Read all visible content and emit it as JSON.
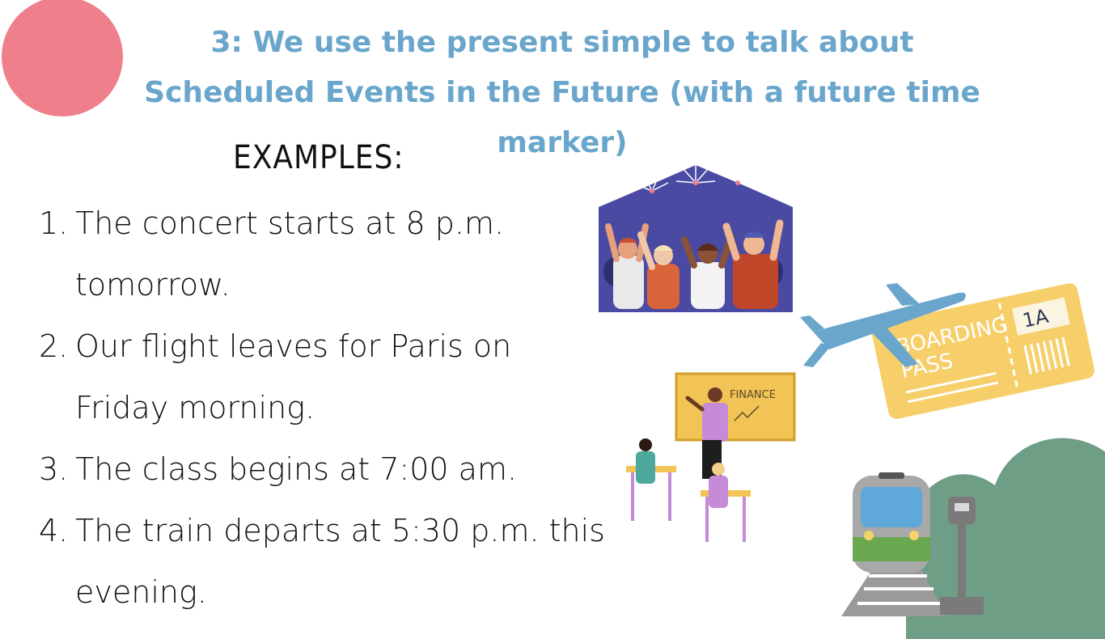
{
  "title_line1": "3: We use the present simple to talk about",
  "title_line2": "Scheduled Events in the Future (with a future time",
  "title_line3": "marker)",
  "examples_heading": "EXAMPLES:",
  "examples": [
    {
      "num": "1.",
      "text": "The concert starts at 8 p.m. tomorrow."
    },
    {
      "num": "2.",
      "text": "Our flight leaves for Paris on Friday morning."
    },
    {
      "num": "3.",
      "text": "The class begins at 7:00 am."
    },
    {
      "num": "4.",
      "text": "The train departs at 5:30 p.m. this evening."
    }
  ],
  "illustrations": {
    "ticket_seat": "1A",
    "ticket_label_1": "BOARDING",
    "ticket_label_2": "PASS",
    "board_label": "FINANCE"
  },
  "colors": {
    "title": "#6aa6cc",
    "pink_blob": "#f07f8c",
    "green_blob": "#6f9e86",
    "ticket": "#f7cf6a",
    "plane": "#6aa6cc"
  }
}
